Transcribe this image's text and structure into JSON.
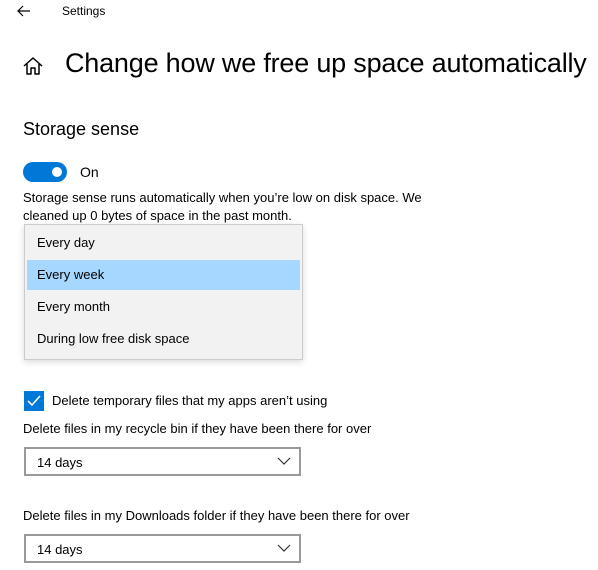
{
  "window": {
    "title": "Settings"
  },
  "page": {
    "title": "Change how we free up space automatically"
  },
  "storage_sense": {
    "heading": "Storage sense",
    "toggle_state": "On",
    "description": "Storage sense runs automatically when you’re low on disk space. We cleaned up 0 bytes of space in the past month."
  },
  "run_dropdown": {
    "options": [
      "Every day",
      "Every week",
      "Every month",
      "During low free disk space"
    ],
    "selected": "Every week"
  },
  "temporary_files": {
    "checkbox_label": "Delete temporary files that my apps aren’t using",
    "checkbox_checked": true,
    "recycle_bin": {
      "label": "Delete files in my recycle bin if they have been there for over",
      "value": "14 days"
    },
    "downloads": {
      "label": "Delete files in my Downloads folder if they have been there for over",
      "value": "14 days"
    }
  },
  "colors": {
    "accent": "#0078d7",
    "selection": "#a6d8ff"
  },
  "icons": {
    "back": "back-arrow-icon",
    "home": "home-icon",
    "checkbox": "checkmark-icon",
    "select": "chevron-down-icon"
  }
}
